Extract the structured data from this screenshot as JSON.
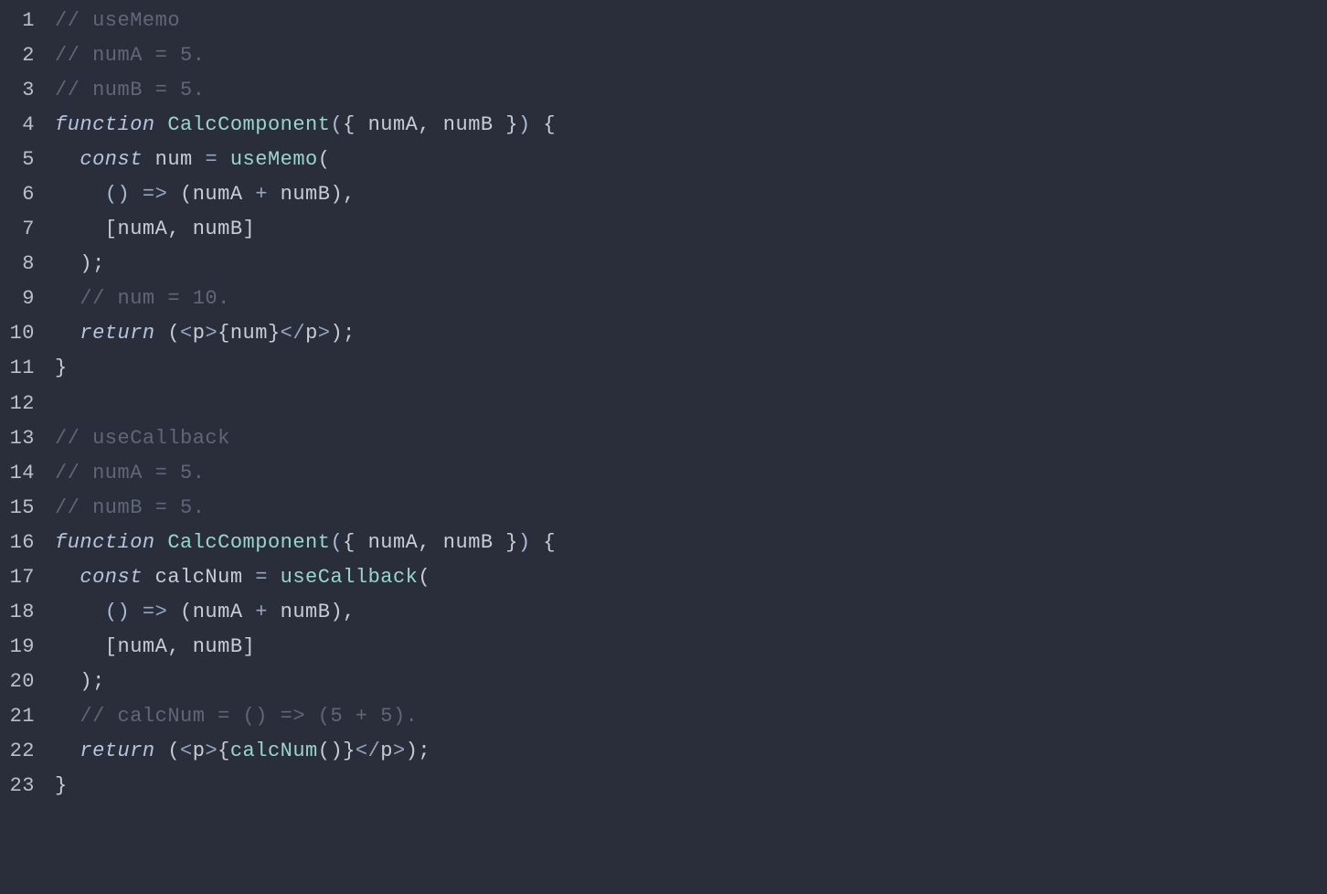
{
  "colors": {
    "background": "#2a2e3b",
    "gutter": "#babfc9",
    "comment": "#5f6776",
    "keyword": "#b4c5de",
    "function": "#96d6cf",
    "default": "#c7cdd8",
    "paren": "#a7bed6",
    "operator": "#95a6c0"
  },
  "lines": [
    {
      "n": "1",
      "segs": [
        {
          "cls": "comment",
          "t": "// useMemo"
        }
      ]
    },
    {
      "n": "2",
      "segs": [
        {
          "cls": "comment",
          "t": "// numA = 5."
        }
      ]
    },
    {
      "n": "3",
      "segs": [
        {
          "cls": "comment",
          "t": "// numB = 5."
        }
      ]
    },
    {
      "n": "4",
      "segs": [
        {
          "cls": "keyword",
          "t": "function"
        },
        {
          "cls": "default",
          "t": " "
        },
        {
          "cls": "fnname",
          "t": "CalcComponent"
        },
        {
          "cls": "paren",
          "t": "("
        },
        {
          "cls": "default",
          "t": "{ numA, numB }"
        },
        {
          "cls": "paren",
          "t": ")"
        },
        {
          "cls": "default",
          "t": " {"
        }
      ]
    },
    {
      "n": "5",
      "segs": [
        {
          "cls": "default",
          "t": "  "
        },
        {
          "cls": "keyword",
          "t": "const"
        },
        {
          "cls": "default",
          "t": " num "
        },
        {
          "cls": "op",
          "t": "="
        },
        {
          "cls": "default",
          "t": " "
        },
        {
          "cls": "fnname",
          "t": "useMemo"
        },
        {
          "cls": "default",
          "t": "("
        }
      ]
    },
    {
      "n": "6",
      "segs": [
        {
          "cls": "default",
          "t": "    "
        },
        {
          "cls": "paren",
          "t": "()"
        },
        {
          "cls": "default",
          "t": " "
        },
        {
          "cls": "op",
          "t": "=>"
        },
        {
          "cls": "default",
          "t": " (numA "
        },
        {
          "cls": "op",
          "t": "+"
        },
        {
          "cls": "default",
          "t": " numB),"
        }
      ]
    },
    {
      "n": "7",
      "segs": [
        {
          "cls": "default",
          "t": "    [numA, numB]"
        }
      ]
    },
    {
      "n": "8",
      "segs": [
        {
          "cls": "default",
          "t": "  );"
        }
      ]
    },
    {
      "n": "9",
      "segs": [
        {
          "cls": "default",
          "t": "  "
        },
        {
          "cls": "comment",
          "t": "// num = 10."
        }
      ]
    },
    {
      "n": "10",
      "segs": [
        {
          "cls": "default",
          "t": "  "
        },
        {
          "cls": "keyword",
          "t": "return"
        },
        {
          "cls": "default",
          "t": " ("
        },
        {
          "cls": "op",
          "t": "<"
        },
        {
          "cls": "default",
          "t": "p"
        },
        {
          "cls": "op",
          "t": ">"
        },
        {
          "cls": "default",
          "t": "{num}"
        },
        {
          "cls": "op",
          "t": "</"
        },
        {
          "cls": "default",
          "t": "p"
        },
        {
          "cls": "op",
          "t": ">"
        },
        {
          "cls": "default",
          "t": ");"
        }
      ]
    },
    {
      "n": "11",
      "segs": [
        {
          "cls": "default",
          "t": "}"
        }
      ]
    },
    {
      "n": "12",
      "segs": [
        {
          "cls": "default",
          "t": ""
        }
      ]
    },
    {
      "n": "13",
      "segs": [
        {
          "cls": "comment",
          "t": "// useCallback"
        }
      ]
    },
    {
      "n": "14",
      "segs": [
        {
          "cls": "comment",
          "t": "// numA = 5."
        }
      ]
    },
    {
      "n": "15",
      "segs": [
        {
          "cls": "comment",
          "t": "// numB = 5."
        }
      ]
    },
    {
      "n": "16",
      "segs": [
        {
          "cls": "keyword",
          "t": "function"
        },
        {
          "cls": "default",
          "t": " "
        },
        {
          "cls": "fnname",
          "t": "CalcComponent"
        },
        {
          "cls": "paren",
          "t": "("
        },
        {
          "cls": "default",
          "t": "{ numA, numB }"
        },
        {
          "cls": "paren",
          "t": ")"
        },
        {
          "cls": "default",
          "t": " {"
        }
      ]
    },
    {
      "n": "17",
      "segs": [
        {
          "cls": "default",
          "t": "  "
        },
        {
          "cls": "keyword",
          "t": "const"
        },
        {
          "cls": "default",
          "t": " calcNum "
        },
        {
          "cls": "op",
          "t": "="
        },
        {
          "cls": "default",
          "t": " "
        },
        {
          "cls": "fnname",
          "t": "useCallback"
        },
        {
          "cls": "default",
          "t": "("
        }
      ]
    },
    {
      "n": "18",
      "segs": [
        {
          "cls": "default",
          "t": "    "
        },
        {
          "cls": "paren",
          "t": "()"
        },
        {
          "cls": "default",
          "t": " "
        },
        {
          "cls": "op",
          "t": "=>"
        },
        {
          "cls": "default",
          "t": " (numA "
        },
        {
          "cls": "op",
          "t": "+"
        },
        {
          "cls": "default",
          "t": " numB),"
        }
      ]
    },
    {
      "n": "19",
      "segs": [
        {
          "cls": "default",
          "t": "    [numA, numB]"
        }
      ]
    },
    {
      "n": "20",
      "segs": [
        {
          "cls": "default",
          "t": "  );"
        }
      ]
    },
    {
      "n": "21",
      "segs": [
        {
          "cls": "default",
          "t": "  "
        },
        {
          "cls": "comment",
          "t": "// calcNum = () => (5 + 5)."
        }
      ]
    },
    {
      "n": "22",
      "segs": [
        {
          "cls": "default",
          "t": "  "
        },
        {
          "cls": "keyword",
          "t": "return"
        },
        {
          "cls": "default",
          "t": " ("
        },
        {
          "cls": "op",
          "t": "<"
        },
        {
          "cls": "default",
          "t": "p"
        },
        {
          "cls": "op",
          "t": ">"
        },
        {
          "cls": "default",
          "t": "{"
        },
        {
          "cls": "fnname",
          "t": "calcNum"
        },
        {
          "cls": "default",
          "t": "()}"
        },
        {
          "cls": "op",
          "t": "</"
        },
        {
          "cls": "default",
          "t": "p"
        },
        {
          "cls": "op",
          "t": ">"
        },
        {
          "cls": "default",
          "t": ");"
        }
      ]
    },
    {
      "n": "23",
      "segs": [
        {
          "cls": "default",
          "t": "}"
        }
      ]
    }
  ]
}
